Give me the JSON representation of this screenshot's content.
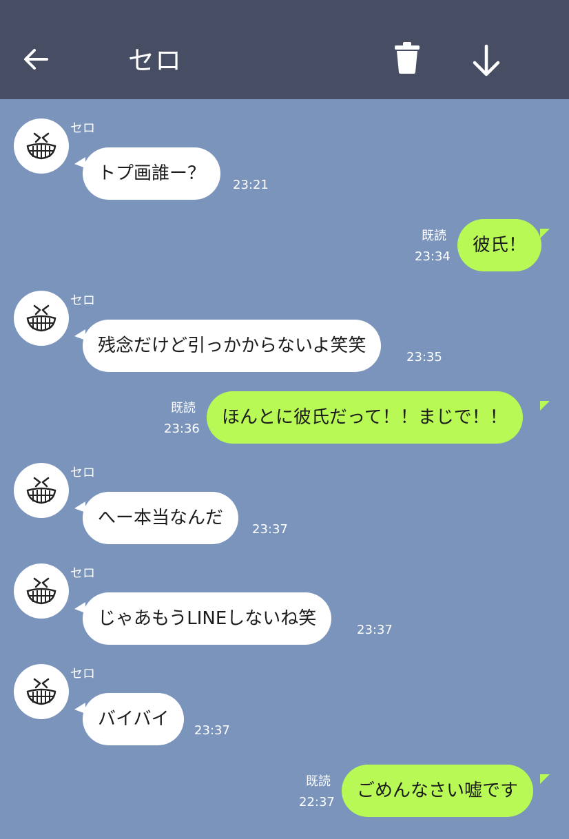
{
  "header": {
    "title": "セロ",
    "back_icon": "arrow-left-icon",
    "trash_icon": "trash-icon",
    "download_icon": "arrow-down-icon",
    "background_color": "#474d62"
  },
  "chat": {
    "background_color": "#7a94bb",
    "incoming_bubble_color": "#ffffff",
    "outgoing_bubble_color": "#b8f956",
    "messages": [
      {
        "direction": "in",
        "sender": "セロ",
        "text": "トプ画誰ー？",
        "time": "23:21"
      },
      {
        "direction": "out",
        "read": "既読",
        "text": "彼氏！",
        "time": "23:34"
      },
      {
        "direction": "in",
        "sender": "セロ",
        "text": "残念だけど引っかからないよ笑笑",
        "time": "23:35"
      },
      {
        "direction": "out",
        "read": "既読",
        "text": "ほんとに彼氏だって！！まじで！！",
        "time": "23:36"
      },
      {
        "direction": "in",
        "sender": "セロ",
        "text": "へー本当なんだ",
        "time": "23:37"
      },
      {
        "direction": "in",
        "sender": "セロ",
        "text": "じゃあもうLINEしないね笑",
        "time": "23:37"
      },
      {
        "direction": "in",
        "sender": "セロ",
        "text": "バイバイ",
        "time": "23:37"
      },
      {
        "direction": "out",
        "read": "既読",
        "text": "ごめんなさい嘘です",
        "time": "22:37"
      }
    ]
  }
}
